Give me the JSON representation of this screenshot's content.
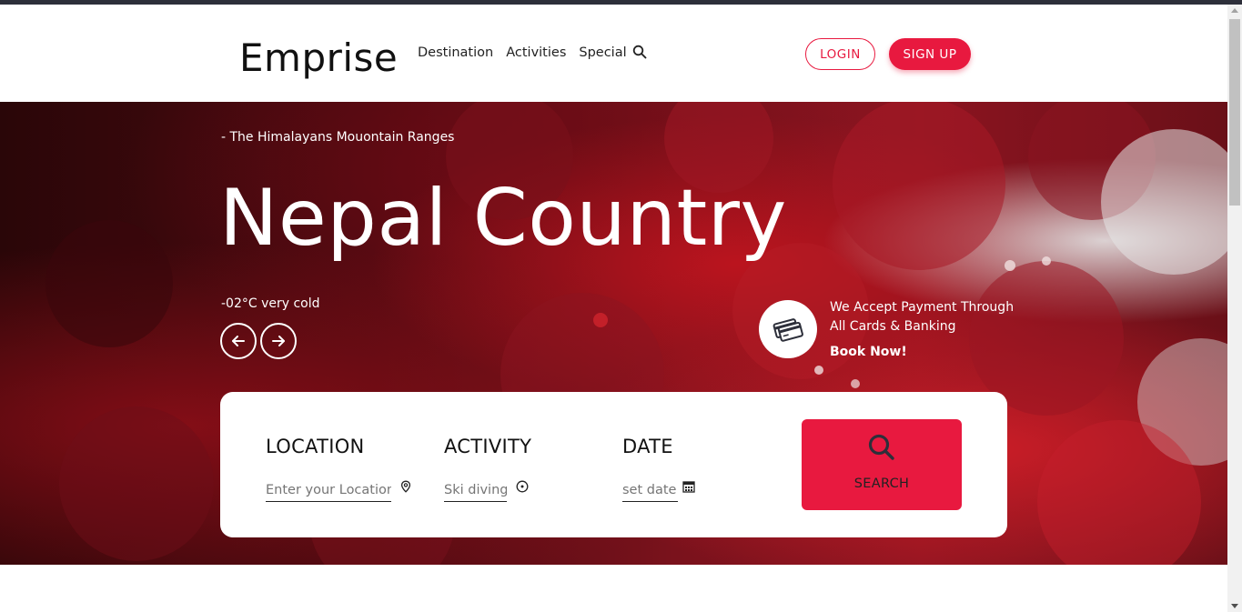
{
  "header": {
    "logo": "Emprise",
    "nav": [
      {
        "label": "Destination"
      },
      {
        "label": "Activities"
      },
      {
        "label": "Special"
      }
    ],
    "login_label": "LOGIN",
    "signup_label": "SIGN UP"
  },
  "hero": {
    "subtitle": "- The Himalayans Mouontain Ranges",
    "title": "Nepal Country",
    "temperature": "-02°C very cold",
    "payment_line1": "We Accept Payment Through",
    "payment_line2": "All Cards & Banking",
    "book_now": "Book Now!"
  },
  "search": {
    "location_label": "LOCATION",
    "location_placeholder": "Enter your Location",
    "activity_label": "ACTIVITY",
    "activity_placeholder": "Ski diving",
    "date_label": "DATE",
    "date_placeholder": "set date",
    "button_label": "SEARCH"
  },
  "colors": {
    "accent": "#e8193f",
    "header_bg": "#ffffff",
    "topbar": "#2d2f3a"
  },
  "icons": [
    "search-icon",
    "arrow-left-icon",
    "arrow-right-icon",
    "credit-card-icon",
    "map-pin-icon",
    "target-icon",
    "calendar-icon"
  ]
}
